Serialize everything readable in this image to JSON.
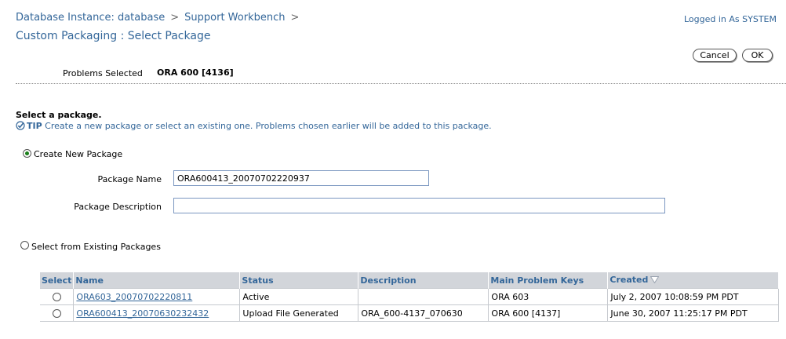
{
  "header": {
    "breadcrumb": [
      "Database Instance: database",
      "Support Workbench"
    ],
    "breadcrumb_separator": ">",
    "title": "Custom Packaging : Select Package",
    "logged_in": "Logged in As SYSTEM"
  },
  "actions": {
    "cancel_label": "Cancel",
    "ok_label": "OK"
  },
  "problems": {
    "label": "Problems Selected",
    "value": "ORA 600 [4136]"
  },
  "section": {
    "title": "Select a package.",
    "tip_label": "TIP",
    "tip_text": "Create a new package or select an existing one. Problems chosen earlier will be added to this package."
  },
  "create_new": {
    "label": "Create New Package",
    "selected": true,
    "package_name_label": "Package Name",
    "package_name_value": "ORA600413_20070702220937",
    "package_description_label": "Package Description",
    "package_description_value": ""
  },
  "existing": {
    "label": "Select from Existing Packages",
    "selected": false
  },
  "table": {
    "columns": [
      "Select",
      "Name",
      "Status",
      "Description",
      "Main Problem Keys",
      "Created"
    ],
    "sorted_column": "Created",
    "rows": [
      {
        "name": "ORA603_20070702220811",
        "status": "Active",
        "description": "",
        "keys": "ORA 603",
        "created": "July 2, 2007 10:08:59 PM PDT"
      },
      {
        "name": "ORA600413_20070630232432",
        "status": "Upload File Generated",
        "description": "ORA_600-4137_070630",
        "keys": "ORA 600 [4137]",
        "created": "June 30, 2007 11:25:17 PM PDT"
      }
    ]
  },
  "colors": {
    "link": "#336699",
    "header_bg": "#d2d5da",
    "radio_on": "#1a7f1a"
  }
}
